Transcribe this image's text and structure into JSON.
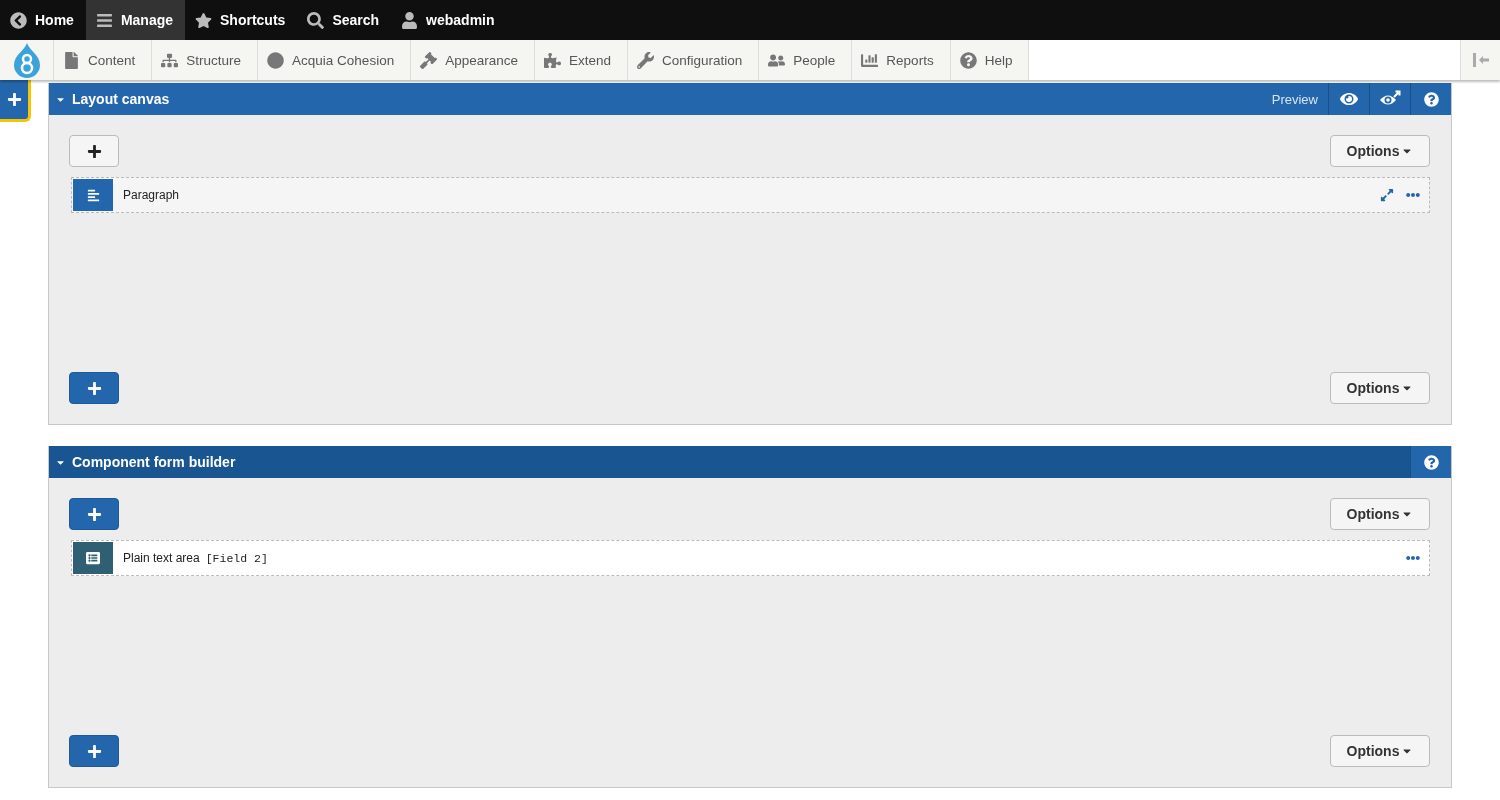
{
  "toolbar": {
    "items": [
      {
        "label": "Home",
        "selected": false
      },
      {
        "label": "Manage",
        "selected": true
      },
      {
        "label": "Shortcuts",
        "selected": false
      },
      {
        "label": "Search",
        "selected": false
      },
      {
        "label": "webadmin",
        "selected": false
      }
    ]
  },
  "admin_menu": {
    "items": [
      {
        "label": "Content"
      },
      {
        "label": "Structure"
      },
      {
        "label": "Acquia Cohesion"
      },
      {
        "label": "Appearance"
      },
      {
        "label": "Extend"
      },
      {
        "label": "Configuration"
      },
      {
        "label": "People"
      },
      {
        "label": "Reports"
      },
      {
        "label": "Help"
      }
    ]
  },
  "panels": [
    {
      "title": "Layout canvas",
      "highlighted": false,
      "preview": {
        "label": "Preview"
      },
      "add_buttons": [
        {
          "primary": false
        },
        {
          "primary": true
        }
      ],
      "options_buttons": [
        "Options",
        "Options"
      ],
      "items": [
        {
          "kind": "paragraph",
          "label": "Paragraph",
          "expandable": true
        }
      ]
    },
    {
      "title": "Component form builder",
      "highlighted": true,
      "add_buttons": [
        {
          "primary": true
        },
        {
          "primary": true
        }
      ],
      "options_buttons": [
        "Options",
        "Options"
      ],
      "items": [
        {
          "kind": "field",
          "label": "Plain text area",
          "tag": "[Field 2]",
          "expandable": false
        }
      ]
    }
  ]
}
